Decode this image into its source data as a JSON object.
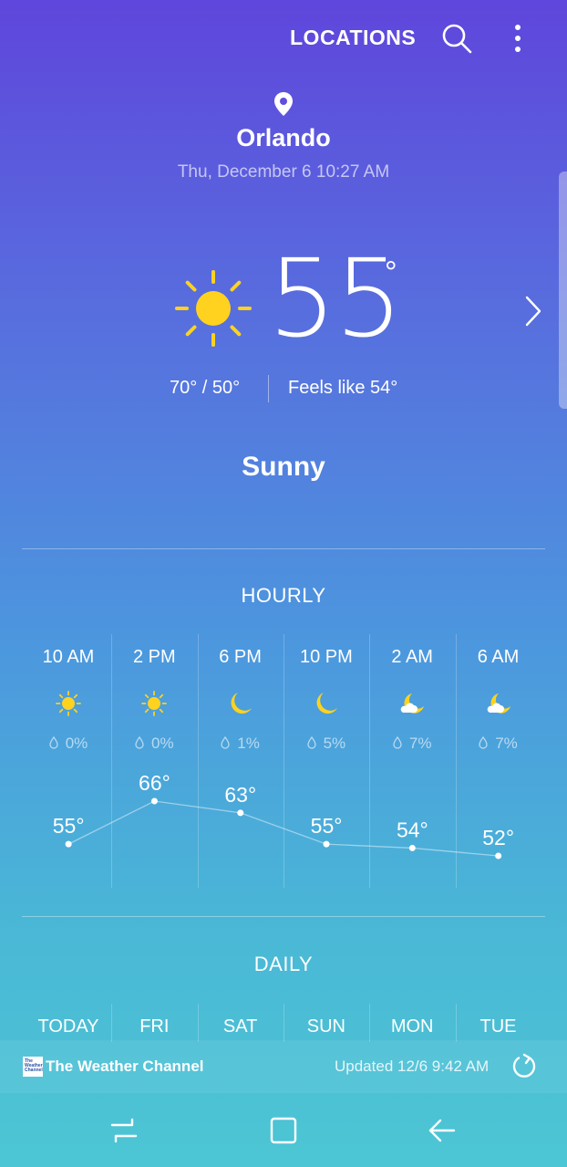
{
  "header": {
    "locations_label": "LOCATIONS"
  },
  "location": {
    "city": "Orlando",
    "datetime": "Thu, December 6 10:27 AM"
  },
  "current": {
    "temp": "55",
    "degree": "°",
    "hi_lo": "70°  /  50°",
    "feels_like": "Feels like 54°",
    "condition": "Sunny"
  },
  "hourly": {
    "title": "HOURLY",
    "items": [
      {
        "time": "10 AM",
        "icon": "sun-icon",
        "precip": "0%",
        "temp": 55,
        "temp_label": "55°"
      },
      {
        "time": "2 PM",
        "icon": "sun-icon",
        "precip": "0%",
        "temp": 66,
        "temp_label": "66°"
      },
      {
        "time": "6 PM",
        "icon": "moon-icon",
        "precip": "1%",
        "temp": 63,
        "temp_label": "63°"
      },
      {
        "time": "10 PM",
        "icon": "moon-icon",
        "precip": "5%",
        "temp": 55,
        "temp_label": "55°"
      },
      {
        "time": "2 AM",
        "icon": "cloud-moon-icon",
        "precip": "7%",
        "temp": 54,
        "temp_label": "54°"
      },
      {
        "time": "6 AM",
        "icon": "cloud-moon-icon",
        "precip": "7%",
        "temp": 52,
        "temp_label": "52°"
      }
    ]
  },
  "daily": {
    "title": "DAILY",
    "days": [
      "TODAY",
      "FRI",
      "SAT",
      "SUN",
      "MON",
      "TUE"
    ]
  },
  "footer": {
    "brand": "The Weather Channel",
    "logo_text": "The Weather Channel",
    "updated": "Updated  12/6  9:42 AM"
  },
  "colors": {
    "icon_yellow": "#ffd21f",
    "text": "#ffffff"
  }
}
